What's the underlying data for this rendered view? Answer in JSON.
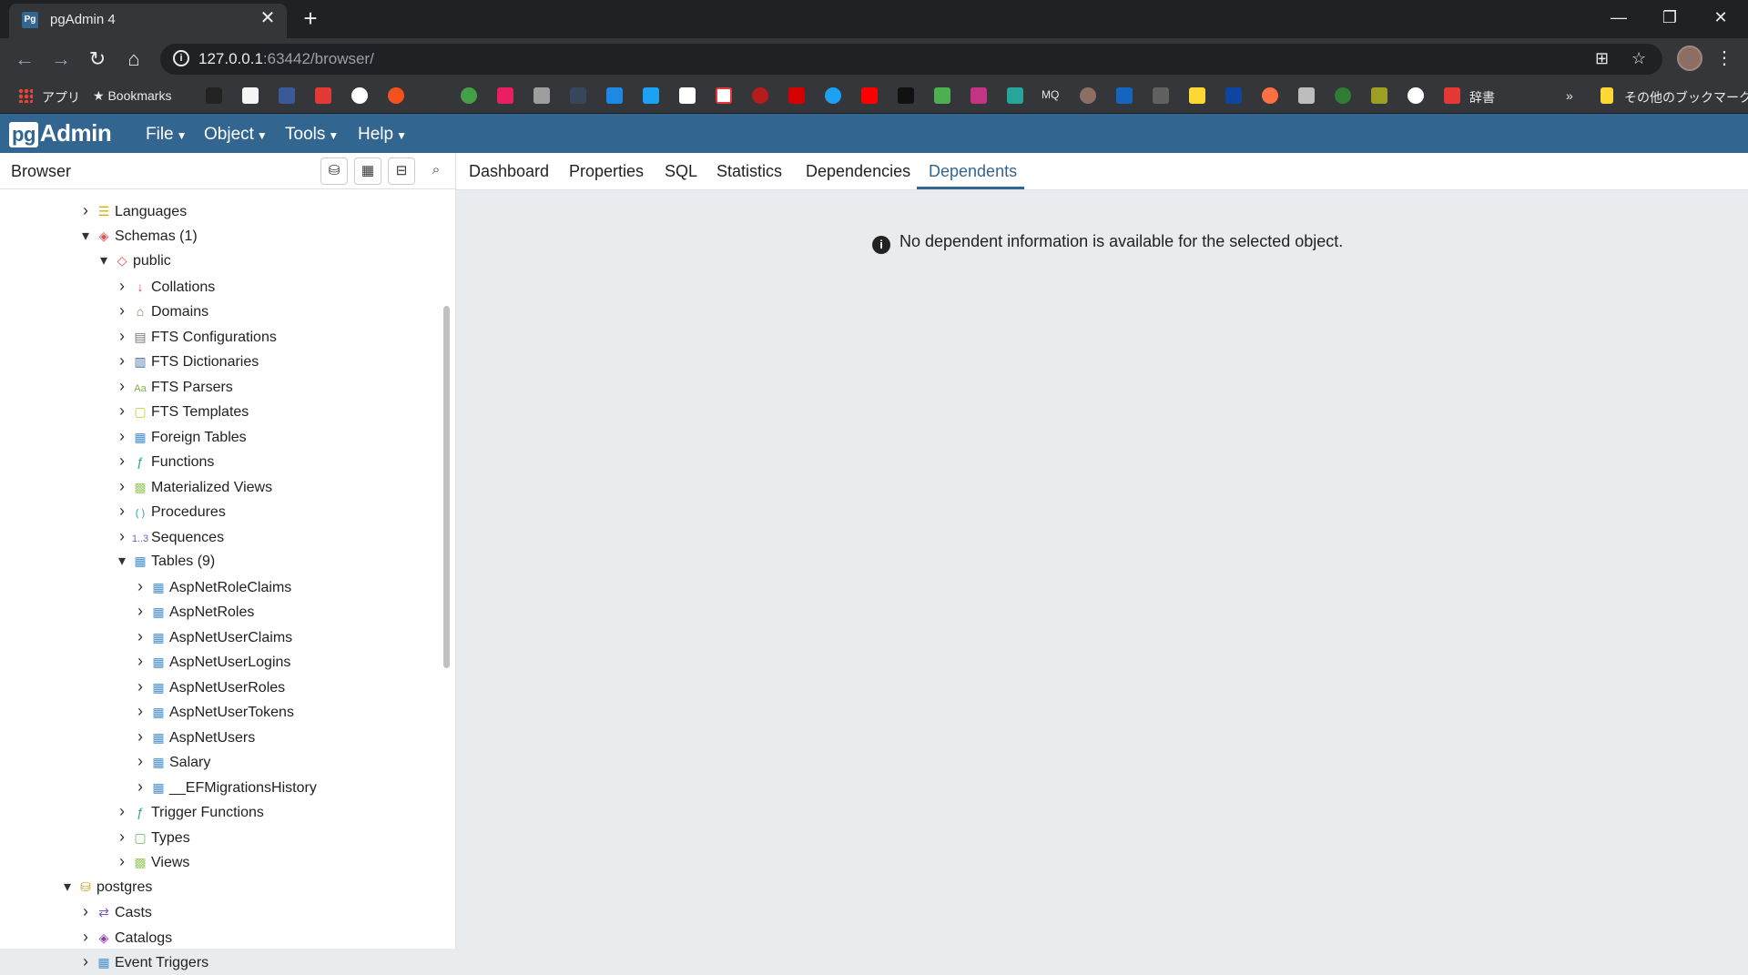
{
  "window": {
    "tab_title": "pgAdmin 4",
    "tab_favicon": "Pg",
    "close_glyph": "✕",
    "new_tab_glyph": "+",
    "minimize_glyph": "—",
    "restore_glyph": "❐",
    "window_close_glyph": "✕"
  },
  "toolbar": {
    "back_icon": "←",
    "forward_icon": "→",
    "reload_icon": "↻",
    "home_icon": "⌂",
    "url_host": "127.0.0.1",
    "url_rest": ":63442/browser/",
    "translate_icon": "⊞",
    "star_icon": "☆",
    "menu_icon": "⋮"
  },
  "bookmarks": {
    "apps_label": "アプリ",
    "bookmarks_label": "Bookmarks",
    "dictionary_label": "辞書",
    "more_label": "»",
    "other_label": "その他のブックマーク"
  },
  "pgadmin": {
    "logo_pg": "pg",
    "logo_text": "Admin",
    "menus": [
      "File",
      "Object",
      "Tools",
      "Help"
    ]
  },
  "browser": {
    "title": "Browser",
    "tree": [
      {
        "label": "Languages",
        "chev": "›",
        "icon": "lang"
      },
      {
        "label": "Schemas (1)",
        "chev": "⌄",
        "icon": "schemas"
      },
      {
        "label": "public",
        "chev": "⌄",
        "icon": "schema"
      },
      {
        "label": "Collations",
        "chev": "›",
        "icon": "collation"
      },
      {
        "label": "Domains",
        "chev": "›",
        "icon": "domain"
      },
      {
        "label": "FTS Configurations",
        "chev": "›",
        "icon": "ftsconf"
      },
      {
        "label": "FTS Dictionaries",
        "chev": "›",
        "icon": "ftsdict"
      },
      {
        "label": "FTS Parsers",
        "chev": "›",
        "icon": "ftsparser"
      },
      {
        "label": "FTS Templates",
        "chev": "›",
        "icon": "ftstemplate"
      },
      {
        "label": "Foreign Tables",
        "chev": "›",
        "icon": "foreigntable"
      },
      {
        "label": "Functions",
        "chev": "›",
        "icon": "function"
      },
      {
        "label": "Materialized Views",
        "chev": "›",
        "icon": "mview"
      },
      {
        "label": "Procedures",
        "chev": "›",
        "icon": "procedure"
      },
      {
        "label": "Sequences",
        "chev": "›",
        "icon": "sequence"
      },
      {
        "label": "Tables (9)",
        "chev": "⌄",
        "icon": "tables"
      },
      {
        "label": "AspNetRoleClaims",
        "chev": "›",
        "icon": "table"
      },
      {
        "label": "AspNetRoles",
        "chev": "›",
        "icon": "table"
      },
      {
        "label": "AspNetUserClaims",
        "chev": "›",
        "icon": "table"
      },
      {
        "label": "AspNetUserLogins",
        "chev": "›",
        "icon": "table"
      },
      {
        "label": "AspNetUserRoles",
        "chev": "›",
        "icon": "table"
      },
      {
        "label": "AspNetUserTokens",
        "chev": "›",
        "icon": "table"
      },
      {
        "label": "AspNetUsers",
        "chev": "›",
        "icon": "table"
      },
      {
        "label": "Salary",
        "chev": "›",
        "icon": "table"
      },
      {
        "label": "__EFMigrationsHistory",
        "chev": "›",
        "icon": "table"
      },
      {
        "label": "Trigger Functions",
        "chev": "›",
        "icon": "triggerfunc"
      },
      {
        "label": "Types",
        "chev": "›",
        "icon": "type"
      },
      {
        "label": "Views",
        "chev": "›",
        "icon": "view"
      },
      {
        "label": "postgres",
        "chev": "⌄",
        "icon": "database"
      },
      {
        "label": "Casts",
        "chev": "›",
        "icon": "cast"
      },
      {
        "label": "Catalogs",
        "chev": "›",
        "icon": "catalog"
      },
      {
        "label": "Event Triggers",
        "chev": "›",
        "icon": "eventtrigger"
      }
    ]
  },
  "main": {
    "tabs": [
      "Dashboard",
      "Properties",
      "SQL",
      "Statistics",
      "Dependencies",
      "Dependents"
    ],
    "active_tab": "Dependents",
    "message": "No dependent information is available for the selected object."
  }
}
